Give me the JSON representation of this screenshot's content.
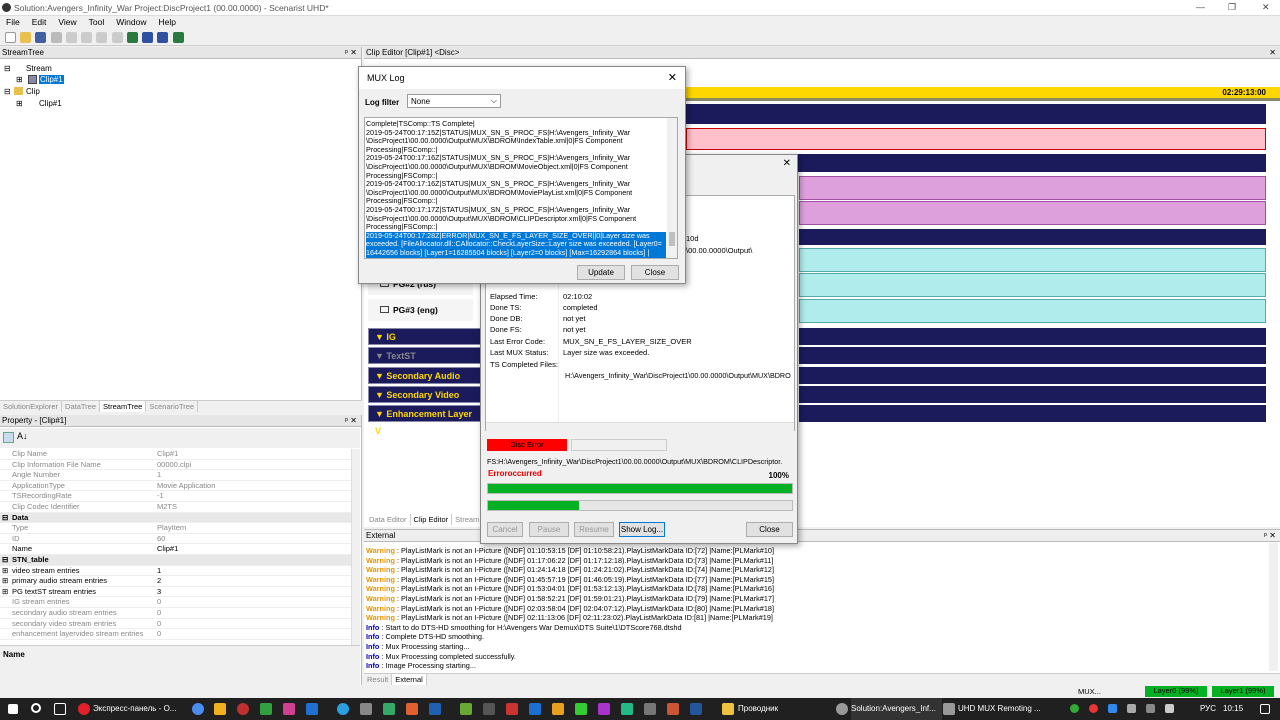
{
  "window": {
    "title": "Solution:Avengers_Infinity_War  Project:DiscProject1 (00.00.0000) - Scenarist UHD*"
  },
  "menu": [
    "File",
    "Edit",
    "View",
    "Tool",
    "Window",
    "Help"
  ],
  "streamtree": {
    "header": "StreamTree",
    "nodes": [
      "Stream",
      "Clip#1",
      "Clip",
      "Clip#1"
    ],
    "tabs": [
      "SolutionExplorer",
      "DataTree",
      "StreamTree",
      "ScenarioTree"
    ]
  },
  "property": {
    "header": "Property - [Clip#1]",
    "rows": [
      {
        "k": "Clip Name",
        "v": "Clip#1"
      },
      {
        "k": "Clip Information File Name",
        "v": "00000.clpi"
      },
      {
        "k": "Angle Number",
        "v": "1"
      },
      {
        "k": "ApplicationType",
        "v": "Movie Application"
      },
      {
        "k": "TSRecordingRate",
        "v": "-1"
      },
      {
        "k": "Clip Codec Identifier",
        "v": "M2TS"
      }
    ],
    "data_section": "Data",
    "data_rows": [
      {
        "k": "Type",
        "v": "PlayItem"
      },
      {
        "k": "ID",
        "v": "60"
      },
      {
        "k": "Name",
        "v": "Clip#1"
      }
    ],
    "stn_section": "STN_table",
    "stn_rows": [
      {
        "k": "video stream entries",
        "v": "1"
      },
      {
        "k": "primary audio stream entries",
        "v": "2"
      },
      {
        "k": "PG textST stream entries",
        "v": "3"
      },
      {
        "k": "IG stream entries",
        "v": "0"
      },
      {
        "k": "secondary audio stream entries",
        "v": "0"
      },
      {
        "k": "secondary video stream entries",
        "v": "0"
      },
      {
        "k": "enhancement layervideo stream entries",
        "v": "0"
      }
    ],
    "desc_title": "Name"
  },
  "clipeditor": {
    "header": "Clip Editor [Clip#1] <Disc>",
    "timecode": "02:29:13:00",
    "pg_labels": [
      "PG#2 (rus)",
      "PG#3 (eng)"
    ],
    "tracks": [
      "IG",
      "TextST",
      "Secondary Audio",
      "Secondary Video",
      "Enhancement Layer V"
    ],
    "tabs": [
      "Data Editor",
      "Clip Editor",
      "Stream E"
    ]
  },
  "muxlog": {
    "title": "MUX Log",
    "filter_label": "Log filter",
    "filter_value": "None",
    "lines": [
      "Complete|TSComp::TS Complete|",
      "2019-05-24T00:17:15Z|STATUS|MUX_SN_S_PROC_FS|H:\\Avengers_Infinity_War",
      "\\DiscProject1\\00.00.0000\\Output\\MUX\\BDROM\\IndexTable.xml|0|FS Component",
      "Processing|FSComp::|",
      "2019-05-24T00:17:16Z|STATUS|MUX_SN_S_PROC_FS|H:\\Avengers_Infinity_War",
      "\\DiscProject1\\00.00.0000\\Output\\MUX\\BDROM\\MovieObject.xml|0|FS Component",
      "Processing|FSComp::|",
      "2019-05-24T00:17:16Z|STATUS|MUX_SN_S_PROC_FS|H:\\Avengers_Infinity_War",
      "\\DiscProject1\\00.00.0000\\Output\\MUX\\BDROM\\MoviePlayList.xml|0|FS Component",
      "Processing|FSComp::|",
      "2019-05-24T00:17:17Z|STATUS|MUX_SN_S_PROC_FS|H:\\Avengers_Infinity_War",
      "\\DiscProject1\\00.00.0000\\Output\\MUX\\BDROM\\CLIPDescriptor.xml|0|FS Component",
      "Processing|FSComp::|"
    ],
    "selected_lines": [
      "2019-05-24T00:17:28Z|ERROR|MUX_SN_E_FS_LAYER_SIZE_OVER||0|Layer size was",
      "exceeded. [FileAllocator.dll::CAllocator::CheckLayerSize::Layer size was exceeded. [Layer0=",
      "16442656 blocks] [Layer1=16285504 blocks] [Layer2=0 blocks] [Max=16292864 blocks] |"
    ],
    "update_label": "Update",
    "close_label": "Close"
  },
  "muxstatus": {
    "partial_text": "10d",
    "partial_path": "\\00.00.0000\\Output\\",
    "rows": [
      {
        "k": "Elapsed Time:",
        "v": "02:10:02"
      },
      {
        "k": "Done TS:",
        "v": "completed"
      },
      {
        "k": "Done DB:",
        "v": "not yet"
      },
      {
        "k": "Done FS:",
        "v": "not yet"
      },
      {
        "k": "Last Error Code:",
        "v": "MUX_SN_E_FS_LAYER_SIZE_OVER"
      },
      {
        "k": "Last MUX Status:",
        "v": "Layer size was exceeded."
      },
      {
        "k": "TS Completed Files:",
        "v": ""
      }
    ],
    "ts_path": "H:\\Avengers_Infinity_War\\DiscProject1\\00.00.0000\\Output\\MUX\\BDRO",
    "disc_error_label": "Disc Error",
    "fs_path": "FS:H:\\Avengers_Infinity_War\\DiscProject1\\00.00.0000\\Output\\MUX\\BDROM\\CLIPDescriptor.",
    "error_text": "Erroroccurred",
    "percent": "100%",
    "progress1": 1.0,
    "progress2": 0.3,
    "buttons": [
      "Cancel",
      "Pause",
      "Resume",
      "Show Log...",
      "Close"
    ]
  },
  "external": {
    "header": "External",
    "lines": [
      {
        "type": "Warning",
        "text": " : PlayListMark is not an I-Picture ([NDF] 01:10:53:15  [DF] 01:10:58:21).PlayListMarkData ID:[72] |Name:[PLMark#10]"
      },
      {
        "type": "Warning",
        "text": " : PlayListMark is not an I-Picture ([NDF] 01:17:06:22  [DF] 01:17:12:18).PlayListMarkData ID:[73] |Name:[PLMark#11]"
      },
      {
        "type": "Warning",
        "text": " : PlayListMark is not an I-Picture ([NDF] 01:24:14:18  [DF] 01:24:21:02).PlayListMarkData ID:[74] |Name:[PLMark#12]"
      },
      {
        "type": "Warning",
        "text": " : PlayListMark is not an I-Picture ([NDF] 01:45:57:19  [DF] 01:46:05:19).PlayListMarkData ID:[77] |Name:[PLMark#15]"
      },
      {
        "type": "Warning",
        "text": " : PlayListMark is not an I-Picture ([NDF] 01:53:04:01  [DF] 01:53:12:13).PlayListMarkData ID:[78] |Name:[PLMark#16]"
      },
      {
        "type": "Warning",
        "text": " : PlayListMark is not an I-Picture ([NDF] 01:58:52:21  [DF] 01:59:01:21).PlayListMarkData ID:[79] |Name:[PLMark#17]"
      },
      {
        "type": "Warning",
        "text": " : PlayListMark is not an I-Picture ([NDF] 02:03:58:04  [DF] 02:04:07:12).PlayListMarkData ID:[80] |Name:[PLMark#18]"
      },
      {
        "type": "Warning",
        "text": " : PlayListMark is not an I-Picture ([NDF] 02:11:13:06  [DF] 02:11:23:02).PlayListMarkData ID:[81] |Name:[PLMark#19]"
      },
      {
        "type": "Info",
        "text": " : Start to do DTS-HD smoothing for H:\\Avengers War Demux\\DTS Suite\\1\\DTScore768.dtshd"
      },
      {
        "type": "Info",
        "text": " : Complete DTS-HD smoothing."
      },
      {
        "type": "Info",
        "text": " : Mux Processing starting..."
      },
      {
        "type": "Info",
        "text": " : Mux Processing completed successfully."
      },
      {
        "type": "Info",
        "text": " : Image Processing starting..."
      }
    ],
    "tabs": [
      "Result",
      "External"
    ]
  },
  "statusbar": {
    "mux": "MUX...",
    "layer0": "Layer0 (99%)",
    "layer1": "Layer1 (99%)"
  },
  "taskbar": {
    "app1": "Экспресс-панель - О...",
    "app2": "Проводник",
    "app3": "Solution:Avengers_Inf...",
    "app4": "UHD MUX Remoting ...",
    "lang": "РУС",
    "time": "10:15"
  }
}
